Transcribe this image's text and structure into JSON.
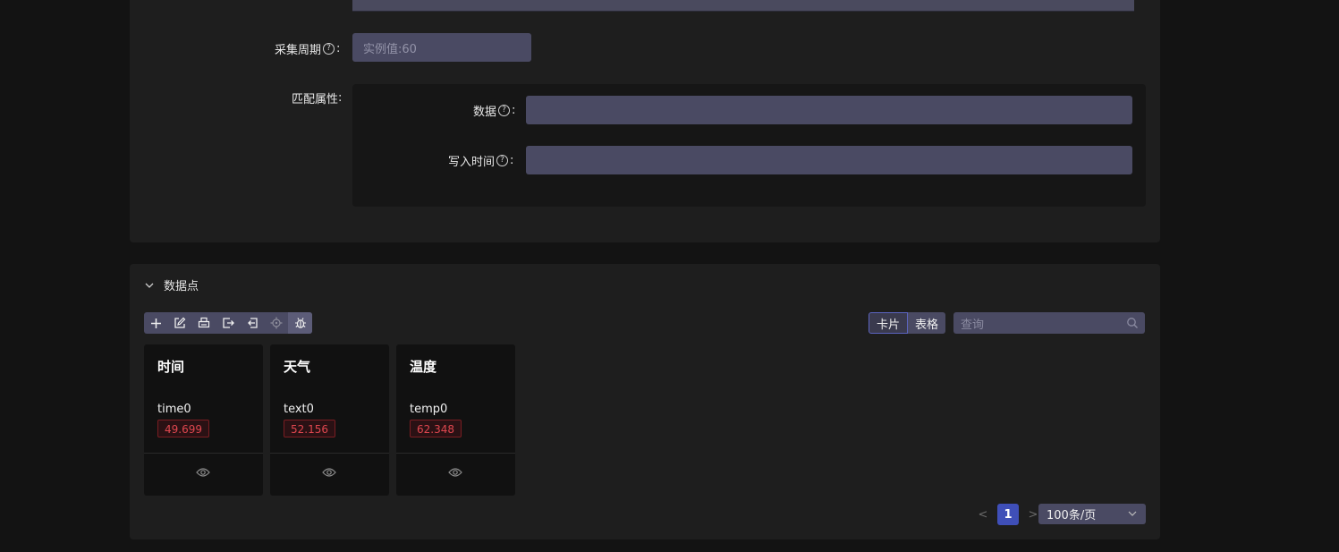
{
  "form": {
    "collect_period_label": "采集周期",
    "collect_period_placeholder": "实例值:60",
    "match_attr_label": "匹配属性",
    "data_label": "数据",
    "write_time_label": "写入时间",
    "colon": ":",
    "help_glyph": "?"
  },
  "datapoints": {
    "section_title": "数据点",
    "toolbar_icons": [
      "plus-icon",
      "edit-icon",
      "printer-icon",
      "export-icon",
      "import-icon",
      "locate-icon",
      "bug-icon"
    ],
    "view_card_label": "卡片",
    "view_table_label": "表格",
    "search_placeholder": "查询",
    "cards": [
      {
        "title": "时间",
        "field": "time0",
        "value": "49.699"
      },
      {
        "title": "天气",
        "field": "text0",
        "value": "52.156"
      },
      {
        "title": "温度",
        "field": "temp0",
        "value": "62.348"
      }
    ],
    "pagination": {
      "prev": "<",
      "current": "1",
      "next": ">",
      "page_size": "100条/页"
    }
  },
  "colors": {
    "background": "#131313",
    "panel": "#1e1e1e",
    "input": "#4a4a63",
    "accent": "#3f4fb8",
    "value_red": "#e0474f"
  }
}
